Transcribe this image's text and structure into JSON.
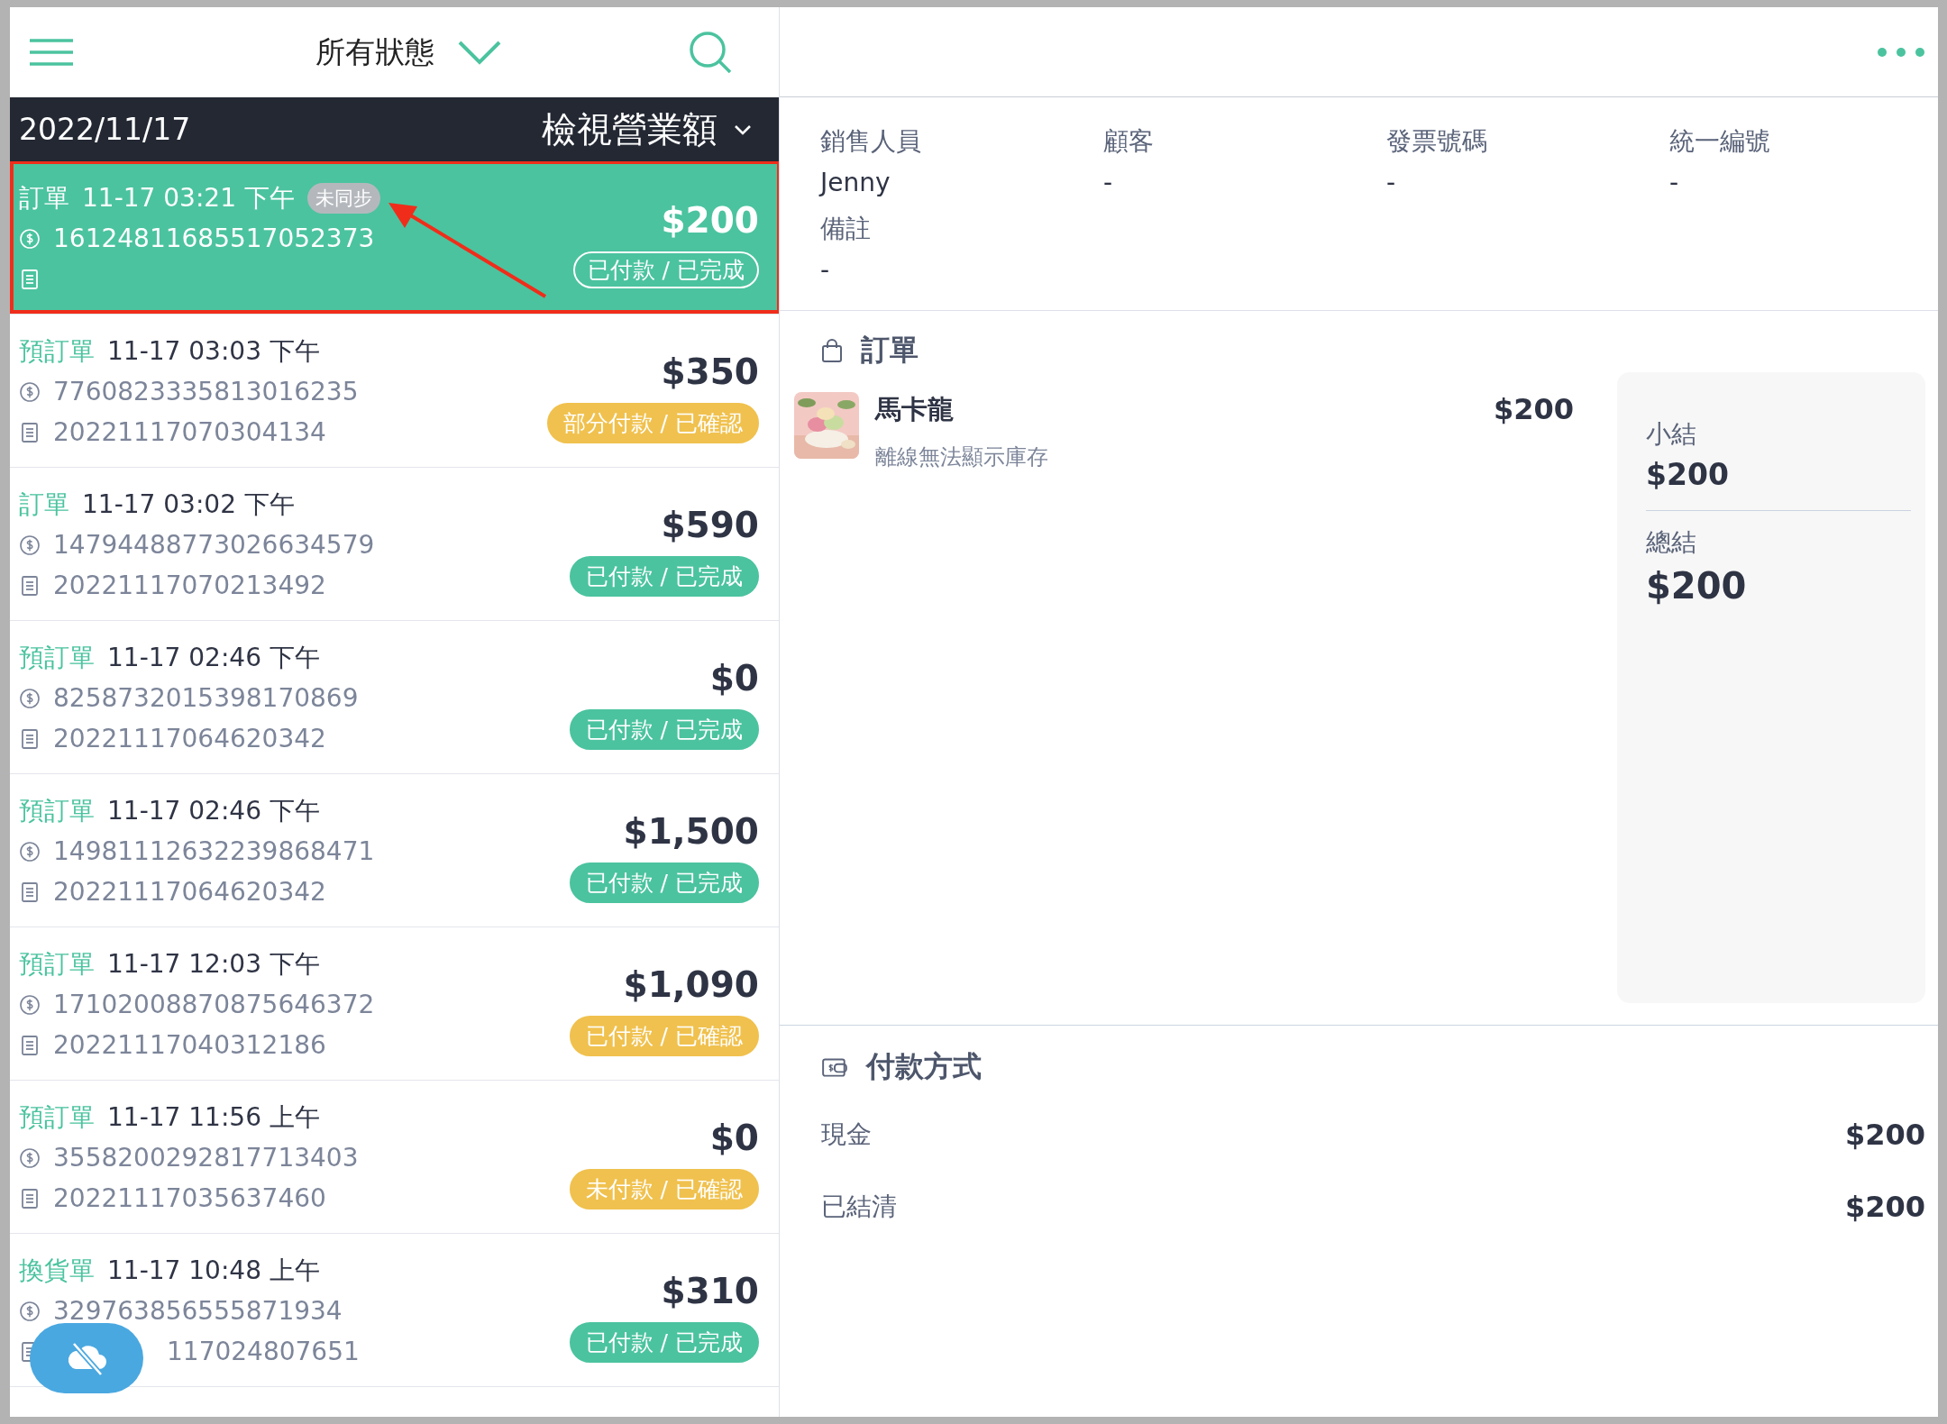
{
  "header": {
    "title": "所有狀態"
  },
  "date_bar": {
    "date": "2022/11/17",
    "action": "檢視營業額"
  },
  "orders": [
    {
      "type": "訂單",
      "time": "11-17 03:21 下午",
      "sync_badge": "未同步",
      "payment_id": "16124811685517052373",
      "amount": "$200",
      "status": {
        "label": "已付款 / 已完成"
      },
      "selected": true,
      "highlighted": true
    },
    {
      "type": "預訂單",
      "time": "11-17 03:03 下午",
      "payment_id": "7760823335813016235",
      "receipt": "20221117070304134",
      "amount": "$350",
      "status": {
        "label": "部分付款 / 已確認",
        "color": "#f0c14e"
      },
      "selected": false,
      "highlighted": false
    },
    {
      "type": "訂單",
      "time": "11-17 03:02 下午",
      "payment_id": "14794488773026634579",
      "receipt": "20221117070213492",
      "amount": "$590",
      "status": {
        "label": "已付款 / 已完成",
        "color": "#4bc39f"
      },
      "selected": false,
      "highlighted": false
    },
    {
      "type": "預訂單",
      "time": "11-17 02:46 下午",
      "payment_id": "8258732015398170869",
      "receipt": "20221117064620342",
      "amount": "$0",
      "status": {
        "label": "已付款 / 已完成",
        "color": "#4bc39f"
      },
      "selected": false,
      "highlighted": false
    },
    {
      "type": "預訂單",
      "time": "11-17 02:46 下午",
      "payment_id": "14981112632239868471",
      "receipt": "20221117064620342",
      "amount": "$1,500",
      "status": {
        "label": "已付款 / 已完成",
        "color": "#4bc39f"
      },
      "selected": false,
      "highlighted": false
    },
    {
      "type": "預訂單",
      "time": "11-17 12:03 下午",
      "payment_id": "17102008870875646372",
      "receipt": "20221117040312186",
      "amount": "$1,090",
      "status": {
        "label": "已付款 / 已確認",
        "color": "#f0c14e"
      },
      "selected": false,
      "highlighted": false
    },
    {
      "type": "預訂單",
      "time": "11-17 11:56 上午",
      "payment_id": "3558200292817713403",
      "receipt": "20221117035637460",
      "amount": "$0",
      "status": {
        "label": "未付款 / 已確認",
        "color": "#f0c14e"
      },
      "selected": false,
      "highlighted": false
    },
    {
      "type": "換貨單",
      "time": "11-17 10:48 上午",
      "payment_id": "329763856555871934",
      "receipt": "117024807651",
      "receipt_partly_covered": true,
      "amount": "$310",
      "status": {
        "label": "已付款 / 已完成",
        "color": "#4bc39f"
      },
      "selected": false,
      "highlighted": false
    }
  ],
  "detail": {
    "fields": [
      {
        "label": "銷售人員",
        "value": "Jenny"
      },
      {
        "label": "顧客",
        "value": "-"
      },
      {
        "label": "發票號碼",
        "value": "-"
      },
      {
        "label": "統一編號",
        "value": "-"
      },
      {
        "label": "備註",
        "value": "-"
      }
    ],
    "order_section": {
      "title": "訂單",
      "items": [
        {
          "kind": "picture",
          "name": "馬卡龍",
          "note": "離線無法顯示庫存",
          "price": "$200"
        }
      ],
      "summary": [
        {
          "kind": "subtotal",
          "label": "小結",
          "value": "$200"
        },
        {
          "kind": "total",
          "label": "總結",
          "value": "$200"
        }
      ]
    },
    "payment_section": {
      "title": "付款方式",
      "lines": [
        {
          "label": "現金",
          "value": "$200"
        },
        {
          "label": "已結清",
          "value": "$200"
        }
      ]
    }
  }
}
